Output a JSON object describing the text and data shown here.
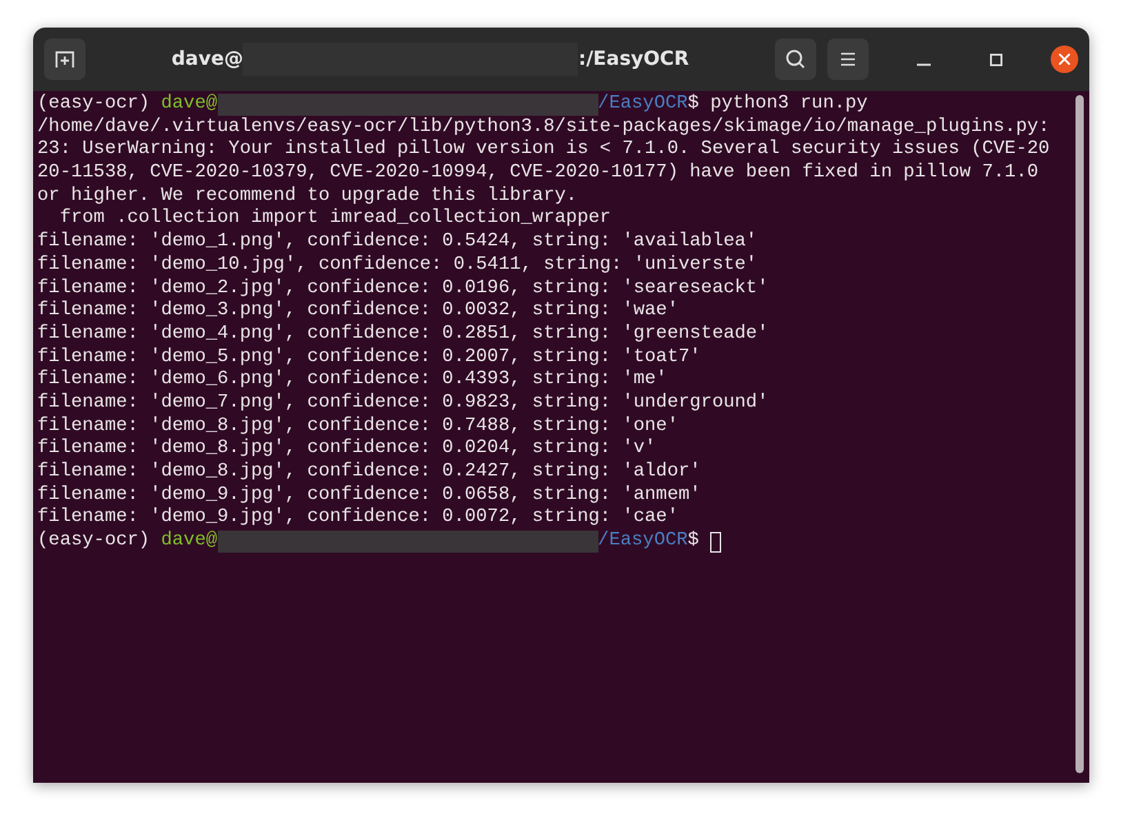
{
  "window": {
    "title_start": "dave@",
    "title_end": ":/EasyOCR"
  },
  "terminal": {
    "lines": [
      {
        "kind": "prompt",
        "env": "(easy-ocr) ",
        "user": "dave@",
        "path": "/EasyOCR",
        "command": "$ python3 run.py",
        "cursor": false
      },
      {
        "kind": "output",
        "text": "/home/dave/.virtualenvs/easy-ocr/lib/python3.8/site-packages/skimage/io/manage_plugins.py:"
      },
      {
        "kind": "output",
        "text": "23: UserWarning: Your installed pillow version is < 7.1.0. Several security issues (CVE-20"
      },
      {
        "kind": "output",
        "text": "20-11538, CVE-2020-10379, CVE-2020-10994, CVE-2020-10177) have been fixed in pillow 7.1.0"
      },
      {
        "kind": "output",
        "text": "or higher. We recommend to upgrade this library."
      },
      {
        "kind": "output",
        "text": "  from .collection import imread_collection_wrapper"
      },
      {
        "kind": "output",
        "text": "filename: 'demo_1.png', confidence: 0.5424, string: 'availablea'"
      },
      {
        "kind": "output",
        "text": "filename: 'demo_10.jpg', confidence: 0.5411, string: 'universte'"
      },
      {
        "kind": "output",
        "text": "filename: 'demo_2.jpg', confidence: 0.0196, string: 'seareseackt'"
      },
      {
        "kind": "output",
        "text": "filename: 'demo_3.png', confidence: 0.0032, string: 'wae'"
      },
      {
        "kind": "output",
        "text": "filename: 'demo_4.png', confidence: 0.2851, string: 'greensteade'"
      },
      {
        "kind": "output",
        "text": "filename: 'demo_5.png', confidence: 0.2007, string: 'toat7'"
      },
      {
        "kind": "output",
        "text": "filename: 'demo_6.png', confidence: 0.4393, string: 'me'"
      },
      {
        "kind": "output",
        "text": "filename: 'demo_7.png', confidence: 0.9823, string: 'underground'"
      },
      {
        "kind": "output",
        "text": "filename: 'demo_8.jpg', confidence: 0.7488, string: 'one'"
      },
      {
        "kind": "output",
        "text": "filename: 'demo_8.jpg', confidence: 0.0204, string: 'v'"
      },
      {
        "kind": "output",
        "text": "filename: 'demo_8.jpg', confidence: 0.2427, string: 'aldor'"
      },
      {
        "kind": "output",
        "text": "filename: 'demo_9.jpg', confidence: 0.0658, string: 'anmem'"
      },
      {
        "kind": "output",
        "text": "filename: 'demo_9.jpg', confidence: 0.0072, string: 'cae'"
      },
      {
        "kind": "prompt",
        "env": "(easy-ocr) ",
        "user": "dave@",
        "path": "/EasyOCR",
        "command": "$ ",
        "cursor": true
      }
    ]
  }
}
